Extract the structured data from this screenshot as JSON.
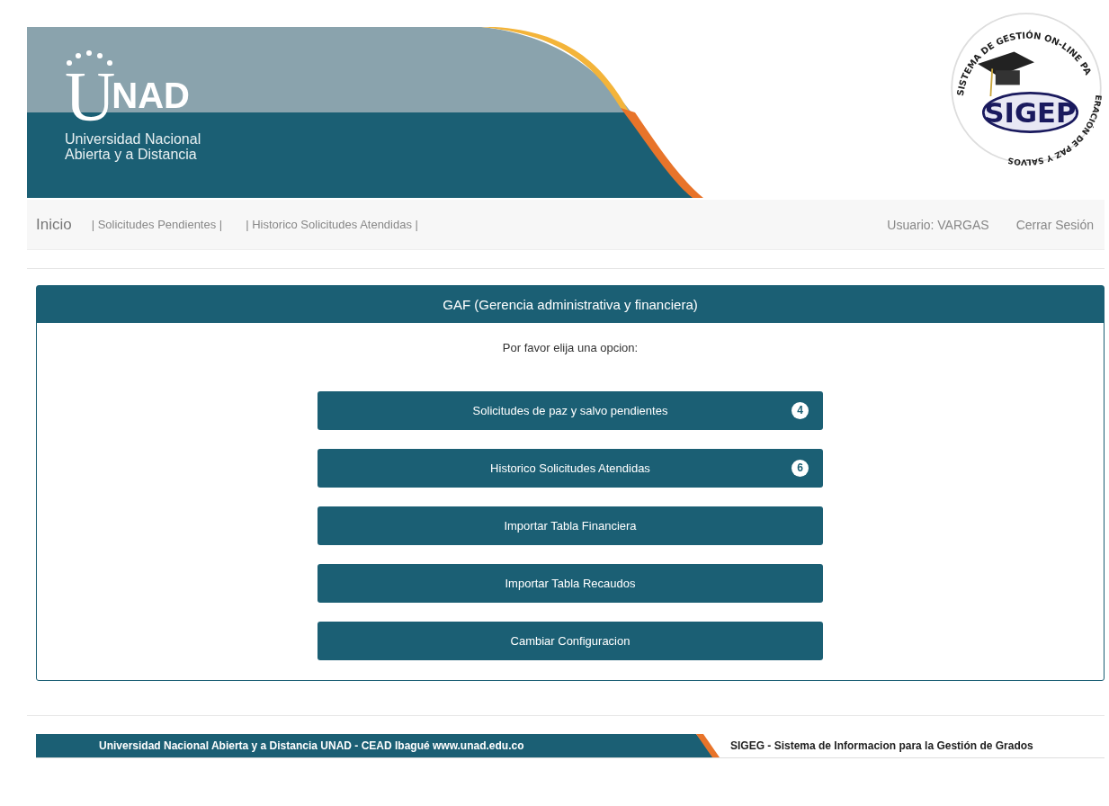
{
  "header": {
    "logo_mark": "U",
    "logo_letters": "NAD",
    "logo_line_1": "Universidad Nacional",
    "logo_line_2": "Abierta y a Distancia",
    "emblem_title": "SIGEP",
    "emblem_ring_top": "SISTEMA DE GESTIÓN ON-LINE PA",
    "emblem_ring_bottom": "ERACIÓN DE PAZ Y SALVOS"
  },
  "nav": {
    "items": [
      {
        "label": "Inicio",
        "kind": "home"
      },
      {
        "label": "| Solicitudes Pendientes |",
        "kind": "link"
      },
      {
        "label": "| Historico Solicitudes Atendidas |",
        "kind": "link"
      }
    ],
    "user": "Usuario: VARGAS",
    "logout": "Cerrar Sesión"
  },
  "panel": {
    "title": "GAF (Gerencia administrativa y financiera)",
    "prompt": "Por favor elija una opcion:",
    "options": [
      {
        "label": "Solicitudes de paz y salvo pendientes",
        "badge": "4"
      },
      {
        "label": "Historico Solicitudes Atendidas",
        "badge": "6"
      },
      {
        "label": "Importar Tabla Financiera"
      },
      {
        "label": "Importar Tabla Recaudos"
      },
      {
        "label": "Cambiar Configuracion"
      }
    ]
  },
  "footer": {
    "left": "Universidad Nacional Abierta y a Distancia UNAD - CEAD Ibagué  www.unad.edu.co",
    "right": "SIGEG - Sistema de Informacion para la Gestión de Grados"
  }
}
